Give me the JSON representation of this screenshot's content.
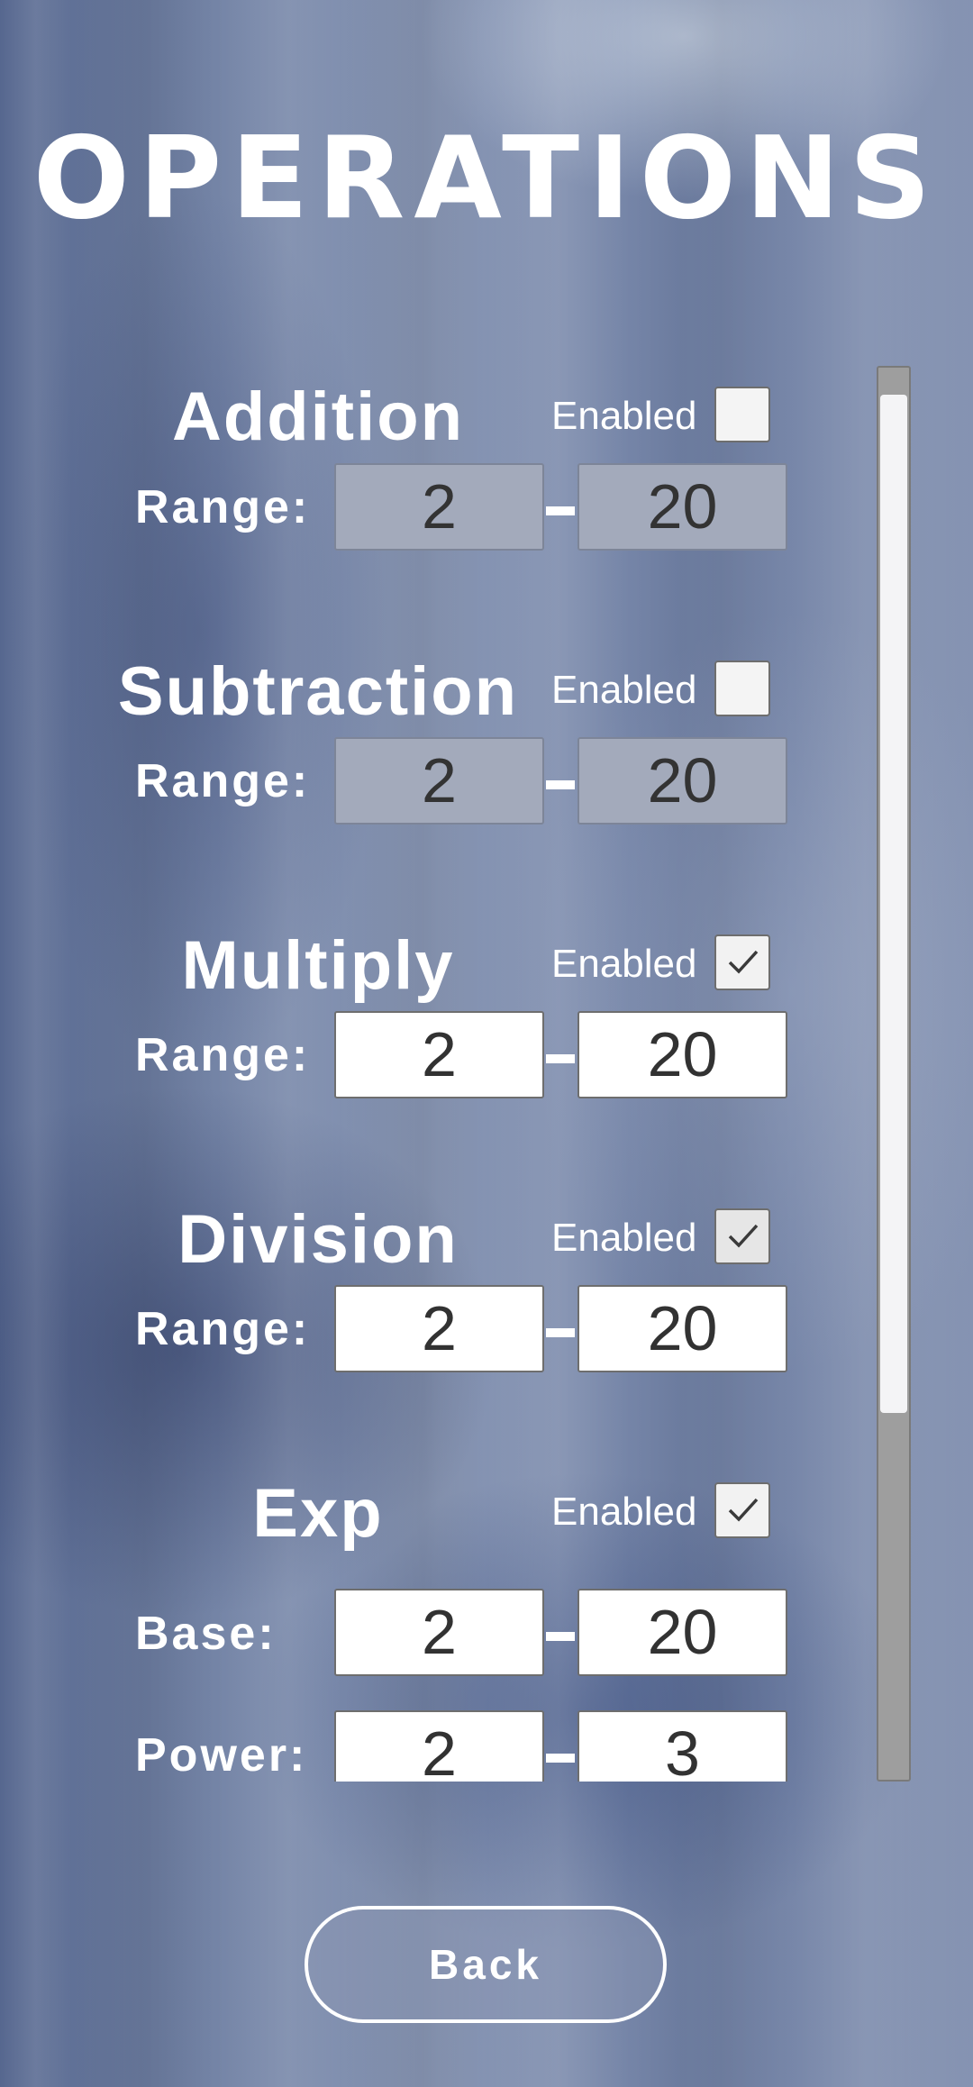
{
  "screen": {
    "title": "OPERATIONS"
  },
  "operations": [
    {
      "name": "Addition",
      "enabled_label": "Enabled",
      "enabled": false,
      "rows": [
        {
          "label": "Range:",
          "min": "2",
          "max": "20"
        }
      ]
    },
    {
      "name": "Subtraction",
      "enabled_label": "Enabled",
      "enabled": false,
      "rows": [
        {
          "label": "Range:",
          "min": "2",
          "max": "20"
        }
      ]
    },
    {
      "name": "Multiply",
      "enabled_label": "Enabled",
      "enabled": true,
      "rows": [
        {
          "label": "Range:",
          "min": "2",
          "max": "20"
        }
      ]
    },
    {
      "name": "Division",
      "enabled_label": "Enabled",
      "enabled": true,
      "rows": [
        {
          "label": "Range:",
          "min": "2",
          "max": "20"
        }
      ]
    },
    {
      "name": "Exp",
      "enabled_label": "Enabled",
      "enabled": true,
      "rows": [
        {
          "label": "Base:",
          "min": "2",
          "max": "20"
        },
        {
          "label": "Power:",
          "min": "2",
          "max": "3"
        }
      ]
    }
  ],
  "back_button": {
    "label": "Back"
  }
}
